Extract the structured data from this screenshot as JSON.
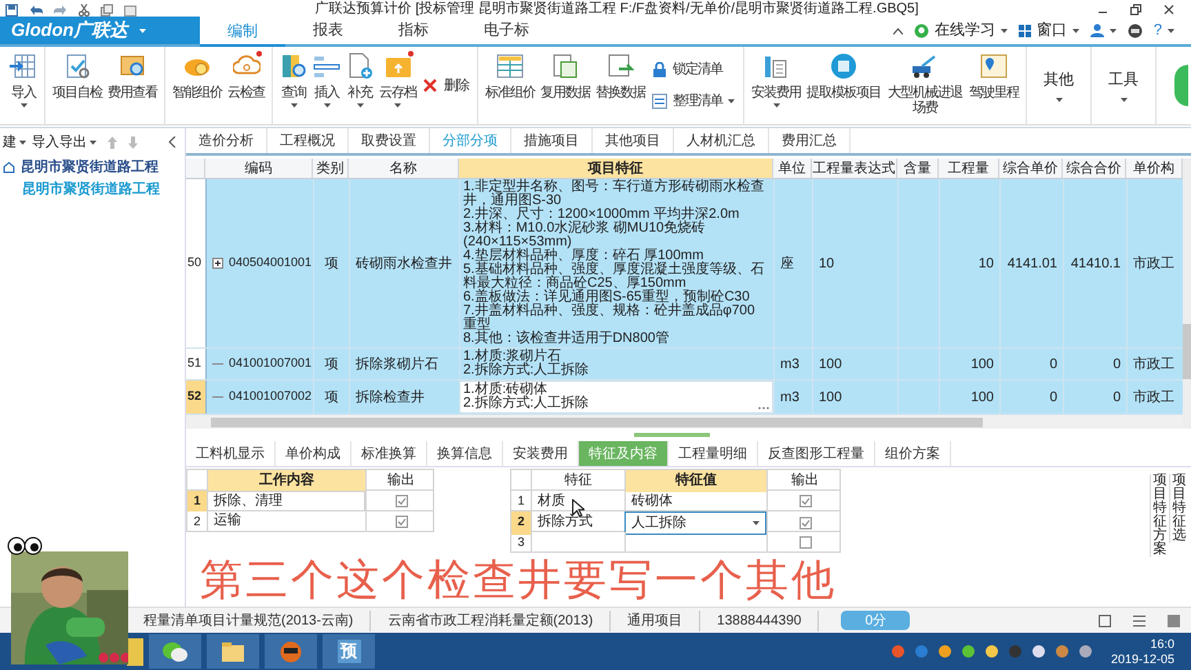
{
  "window": {
    "title": "广联达预算计价 [投标管理 昆明市聚贤街道路工程 F:/F盘资料/无单价/昆明市聚贤街道路工程.GBQ5]"
  },
  "ribbon": {
    "logo": "Glodon广联达",
    "tabs": [
      {
        "label": "编制",
        "selected": true
      },
      {
        "label": "报表",
        "selected": false
      },
      {
        "label": "指标",
        "selected": false
      },
      {
        "label": "电子标",
        "selected": false
      }
    ],
    "right": {
      "online": "在线学习",
      "window_menu": "窗口",
      "help": "?"
    },
    "groups": [
      [
        {
          "kind": "large",
          "label": "导入",
          "dropdown": true,
          "notification": false
        }
      ],
      [
        {
          "kind": "large",
          "label": "项目自检",
          "dropdown": false,
          "notification": false
        },
        {
          "kind": "large",
          "label": "费用查看",
          "dropdown": false,
          "notification": false
        }
      ],
      [
        {
          "kind": "large",
          "label": "智能组价",
          "dropdown": false,
          "notification": false
        },
        {
          "kind": "large",
          "label": "云检查",
          "dropdown": false,
          "notification": true
        }
      ],
      [
        {
          "kind": "large",
          "label": "查询",
          "dropdown": true,
          "notification": false
        },
        {
          "kind": "large",
          "label": "插入",
          "dropdown": true,
          "notification": false
        },
        {
          "kind": "large",
          "label": "补充",
          "dropdown": true,
          "notification": false
        },
        {
          "kind": "large",
          "label": "云存档",
          "dropdown": true,
          "notification": true
        },
        {
          "kind": "small",
          "label": "删除",
          "dropdown": false
        }
      ],
      [
        {
          "kind": "large",
          "label": "标准组价",
          "dropdown": false,
          "notification": false
        },
        {
          "kind": "large",
          "label": "复用数据",
          "dropdown": false,
          "notification": false
        },
        {
          "kind": "large",
          "label": "替换数据",
          "dropdown": false,
          "notification": false
        },
        {
          "kind": "small",
          "label": "锁定清单",
          "dropdown": false
        },
        {
          "kind": "small",
          "label": "整理清单",
          "dropdown": true
        }
      ],
      [
        {
          "kind": "large",
          "label": "安装费用",
          "dropdown": true,
          "notification": false
        },
        {
          "kind": "large",
          "label": "提取模板项目",
          "dropdown": false,
          "notification": false
        },
        {
          "kind": "large",
          "label": "大型机械进退场费",
          "dropdown": false,
          "notification": false
        },
        {
          "kind": "large",
          "label": "驾驶里程",
          "dropdown": false,
          "notification": false
        }
      ],
      [
        {
          "kind": "text",
          "label": "其他",
          "dropdown": true
        }
      ],
      [
        {
          "kind": "text",
          "label": "工具",
          "dropdown": true
        }
      ]
    ]
  },
  "sidebar": {
    "toolbar": {
      "new": "建",
      "import_export": "导入导出"
    },
    "tree": [
      {
        "label": "昆明市聚贤街道路工程",
        "selected": false,
        "children": [
          {
            "label": "昆明市聚贤街道路工程",
            "selected": true
          }
        ]
      }
    ]
  },
  "page_tabs": [
    {
      "label": "造价分析",
      "selected": false
    },
    {
      "label": "工程概况",
      "selected": false
    },
    {
      "label": "取费设置",
      "selected": false
    },
    {
      "label": "分部分项",
      "selected": true
    },
    {
      "label": "措施项目",
      "selected": false
    },
    {
      "label": "其他项目",
      "selected": false
    },
    {
      "label": "人材机汇总",
      "selected": false
    },
    {
      "label": "费用汇总",
      "selected": false
    }
  ],
  "table": {
    "columns": [
      {
        "label": "编码",
        "selected": false
      },
      {
        "label": "类别",
        "selected": false
      },
      {
        "label": "名称",
        "selected": false
      },
      {
        "label": "项目特征",
        "selected": true
      },
      {
        "label": "单位",
        "selected": false
      },
      {
        "label": "工程量表达式",
        "selected": false
      },
      {
        "label": "含量",
        "selected": false
      },
      {
        "label": "工程量",
        "selected": false
      },
      {
        "label": "综合单价",
        "selected": false
      },
      {
        "label": "综合合价",
        "selected": false
      },
      {
        "label": "单价构",
        "selected": false
      }
    ],
    "rows": [
      {
        "number": "50",
        "expandable": true,
        "selected": false,
        "code": "040504001001",
        "type": "项",
        "name": "砖砌雨水检查井",
        "feature": "1.非定型井名称、图号：车行道方形砖砌雨水检查井，通用图S-30\n2.井深、尺寸：1200×1000mm 平均井深2.0m\n3.材料：M10.0水泥砂浆 砌MU10免烧砖(240×115×53mm)\n4.垫层材料品种、厚度：碎石 厚100mm\n5.基础材料品种、强度、厚度混凝土强度等级、石料最大粒径：商品砼C25、厚150mm\n6.盖板做法：详见通用图S-65重型，预制砼C30\n7.井盖材料品种、强度、规格：砼井盖成品φ700 重型\n8.其他：该检查井适用于DN800管",
        "unit": "座",
        "expression": "10",
        "quantity": "10",
        "unit_price": "4141.01",
        "total": "41410.1",
        "price_basis": "市政工"
      },
      {
        "number": "51",
        "expandable": false,
        "selected": false,
        "code": "041001007001",
        "type": "项",
        "name": "拆除浆砌片石",
        "feature": "1.材质:浆砌片石\n2.拆除方式:人工拆除",
        "unit": "m3",
        "expression": "100",
        "quantity": "100",
        "unit_price": "0",
        "total": "0",
        "price_basis": "市政工"
      },
      {
        "number": "52",
        "expandable": false,
        "selected": true,
        "code": "041001007002",
        "type": "项",
        "name": "拆除检查井",
        "feature": "1.材质:砖砌体\n2.拆除方式:人工拆除",
        "unit": "m3",
        "expression": "100",
        "quantity": "100",
        "unit_price": "0",
        "total": "0",
        "price_basis": "市政工"
      }
    ]
  },
  "detail_tabs": [
    {
      "label": "工料机显示",
      "selected": false
    },
    {
      "label": "单价构成",
      "selected": false
    },
    {
      "label": "标准换算",
      "selected": false
    },
    {
      "label": "换算信息",
      "selected": false
    },
    {
      "label": "安装费用",
      "selected": false
    },
    {
      "label": "特征及内容",
      "selected": true
    },
    {
      "label": "工程量明细",
      "selected": false
    },
    {
      "label": "反查图形工程量",
      "selected": false
    },
    {
      "label": "组价方案",
      "selected": false
    }
  ],
  "work_content": {
    "columns": [
      "工作内容",
      "输出"
    ],
    "rows": [
      {
        "number": "1",
        "content": "拆除、清理",
        "output": true,
        "selected": true
      },
      {
        "number": "2",
        "content": "运输",
        "output": true,
        "selected": false
      }
    ]
  },
  "features": {
    "columns": [
      "特征",
      "特征值",
      "输出"
    ],
    "rows": [
      {
        "number": "1",
        "feature": "材质",
        "value": "砖砌体",
        "output": true,
        "selected": false,
        "kind": "text"
      },
      {
        "number": "2",
        "feature": "拆除方式",
        "value": "人工拆除",
        "output": true,
        "selected": true,
        "kind": "dropdown"
      },
      {
        "number": "3",
        "output": false,
        "selected": false,
        "kind": "text"
      }
    ]
  },
  "side_labels": [
    "项目特征方案",
    "项目特征选"
  ],
  "subtitle": "第三个这个检查井要写一个其他",
  "status_bar": {
    "items": [
      "程量清单项目计量规范(2013-云南)",
      "云南省市政工程消耗量定额(2013)",
      "通用项目",
      "13888444390"
    ],
    "score": "0分"
  },
  "taskbar": {
    "app_label": "预",
    "clock": "16:0",
    "date": "2019-12-05"
  }
}
